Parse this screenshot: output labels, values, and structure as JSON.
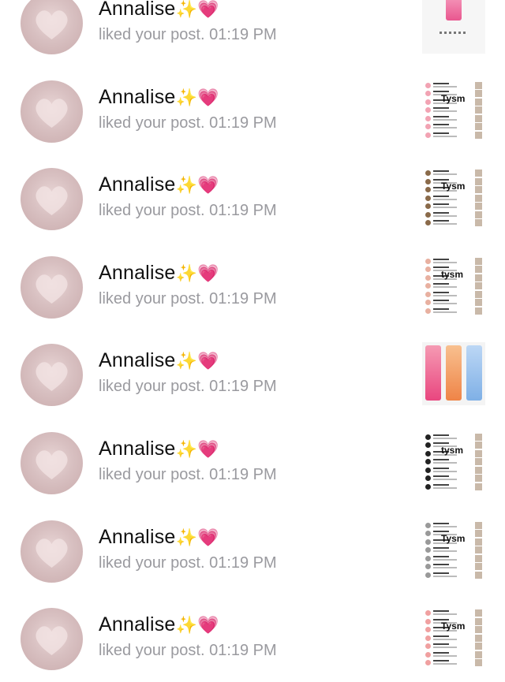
{
  "notifications": [
    {
      "user": "Annalise",
      "emoji_sparkles": "✨",
      "emoji_heart": "💗",
      "action": "liked your post.",
      "time": "01:19 PM",
      "thumb_type": "product-pink"
    },
    {
      "user": "Annalise",
      "emoji_sparkles": "✨",
      "emoji_heart": "💗",
      "action": "liked your post.",
      "time": "01:19 PM",
      "thumb_type": "list-tysm",
      "tag": "Tysm",
      "dot_color": "#f2a3b3"
    },
    {
      "user": "Annalise",
      "emoji_sparkles": "✨",
      "emoji_heart": "💗",
      "action": "liked your post.",
      "time": "01:19 PM",
      "thumb_type": "list-tysm",
      "tag": "Tysm",
      "dot_color": "#8a6a4a"
    },
    {
      "user": "Annalise",
      "emoji_sparkles": "✨",
      "emoji_heart": "💗",
      "action": "liked your post.",
      "time": "01:19 PM",
      "thumb_type": "list-tysm",
      "tag": "tysm",
      "dot_color": "#e8b0a0"
    },
    {
      "user": "Annalise",
      "emoji_sparkles": "✨",
      "emoji_heart": "💗",
      "action": "liked your post.",
      "time": "01:19 PM",
      "thumb_type": "product-bottles"
    },
    {
      "user": "Annalise",
      "emoji_sparkles": "✨",
      "emoji_heart": "💗",
      "action": "liked your post.",
      "time": "01:19 PM",
      "thumb_type": "list-tysm",
      "tag": "tysm",
      "dot_color": "#222222"
    },
    {
      "user": "Annalise",
      "emoji_sparkles": "✨",
      "emoji_heart": "💗",
      "action": "liked your post.",
      "time": "01:19 PM",
      "thumb_type": "list-tysm",
      "tag": "Tysm",
      "dot_color": "#999999"
    },
    {
      "user": "Annalise",
      "emoji_sparkles": "✨",
      "emoji_heart": "💗",
      "action": "liked your post.",
      "time": "01:19 PM",
      "thumb_type": "list-tysm",
      "tag": "Tysm",
      "dot_color": "#f0a0a0"
    }
  ]
}
